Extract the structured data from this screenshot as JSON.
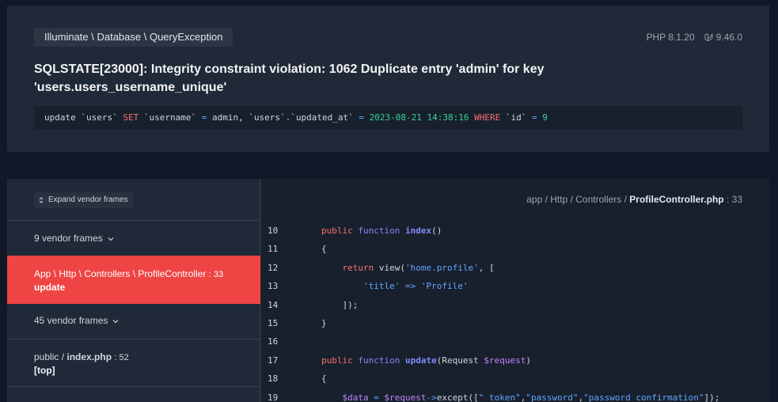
{
  "exception": {
    "class": "Illuminate \\ Database \\ QueryException",
    "php_version": "PHP 8.1.20",
    "laravel_version": "9.46.0",
    "message": "SQLSTATE[23000]: Integrity constraint violation: 1062 Duplicate entry 'admin' for key 'users.users_username_unique'"
  },
  "sql": {
    "p1": "update `users` ",
    "kw_set": "SET",
    "p2": " `username` ",
    "eq1": "=",
    "p3": " admin, `users`.`updated_at` ",
    "eq2": "=",
    "date": " 2023-08-21 14:38:16 ",
    "kw_where": "WHERE",
    "p4": " `id` ",
    "eq3": "=",
    "id": " 9"
  },
  "frames": {
    "expand_label": "Expand vendor frames",
    "vendor1": "9 vendor frames",
    "active_path": "App \\ Http \\ Controllers \\ ProfileController",
    "active_line": ": 33",
    "active_method": "update",
    "vendor2": "45 vendor frames",
    "public_prefix": "public / ",
    "public_file": "index.php",
    "public_line": ": 52",
    "public_method": "[top]"
  },
  "code": {
    "path_prefix": "app / Http / Controllers / ",
    "file": "ProfileController.php",
    "line": ": 33",
    "lines": [
      {
        "n": "10"
      },
      {
        "n": "11"
      },
      {
        "n": "12"
      },
      {
        "n": "13"
      },
      {
        "n": "14"
      },
      {
        "n": "15"
      },
      {
        "n": "16"
      },
      {
        "n": "17"
      },
      {
        "n": "18"
      },
      {
        "n": "19"
      }
    ]
  },
  "colors": {
    "background": "#111827",
    "card": "#1f2937",
    "active_frame": "#ef4444",
    "keyword": "#f87171",
    "string": "#60a5fa",
    "function": "#818cf8"
  }
}
